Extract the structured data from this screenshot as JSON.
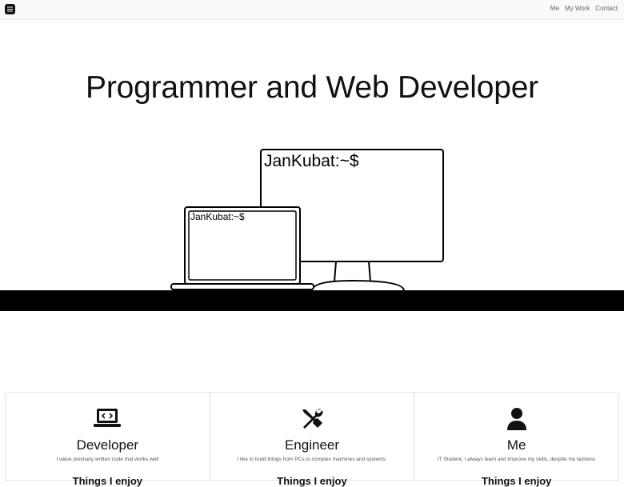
{
  "nav": {
    "links": [
      "Me",
      "My Work",
      "Contact"
    ]
  },
  "hero": {
    "title": "Programmer and Web Developer",
    "prompt_big": "JanKubat:~$",
    "prompt_small": "JanKubat:~$"
  },
  "cards": [
    {
      "icon": "laptop-code-icon",
      "title": "Developer",
      "text": "I value precisely written code that works well",
      "sub": "Things I enjoy"
    },
    {
      "icon": "tools-icon",
      "title": "Engineer",
      "text": "I like to build things from PCs to complex machines and systems.",
      "sub": "Things I enjoy"
    },
    {
      "icon": "user-icon",
      "title": "Me",
      "text": "IT Student, I always learn and improve my skills, despite my laziness",
      "sub": "Things I enjoy"
    }
  ]
}
